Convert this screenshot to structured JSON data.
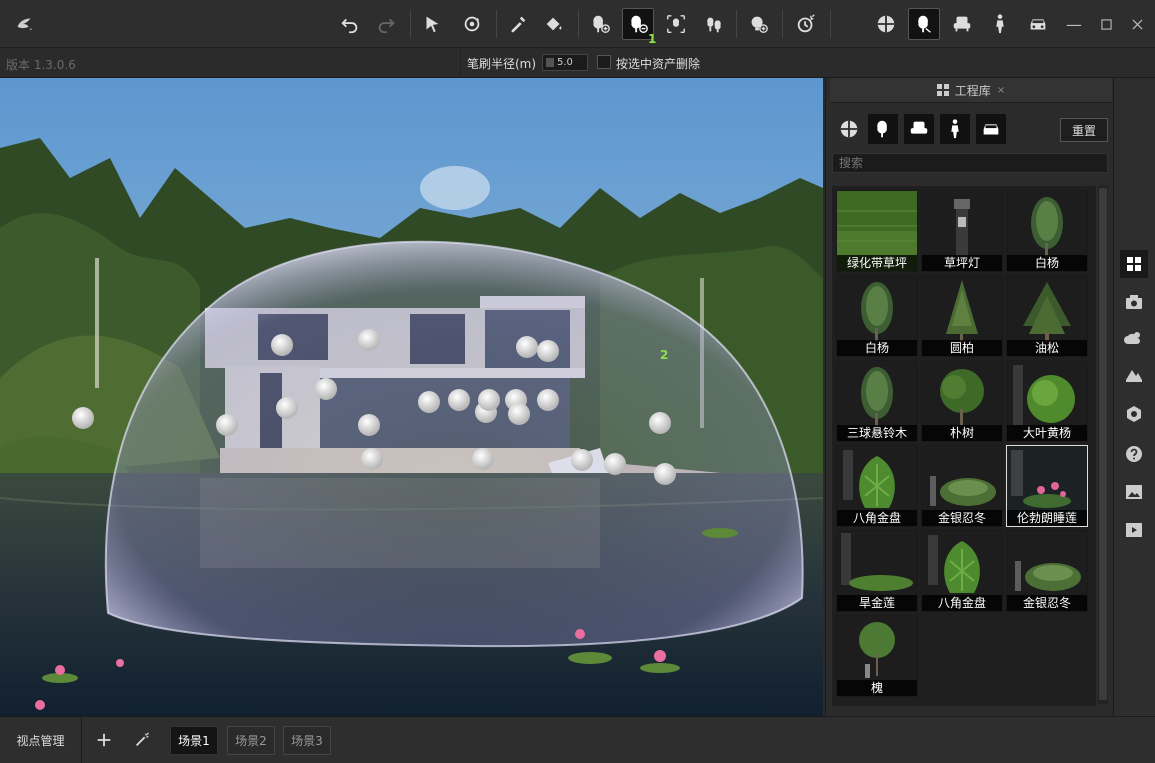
{
  "toolbar": {
    "badge_label": "1"
  },
  "subbar": {
    "version": "版本 1.3.0.6",
    "brush_label": "笔刷半径(m)",
    "brush_value": "5.0",
    "delete_label": "按选中资产删除"
  },
  "viewport": {
    "dome_label": "2"
  },
  "panel": {
    "title": "工程库",
    "reset_label": "重置",
    "search_placeholder": "搜索",
    "assets": [
      {
        "label": "绿化带草坪",
        "icon": "grass"
      },
      {
        "label": "草坪灯",
        "icon": "lamp"
      },
      {
        "label": "白杨",
        "icon": "tree-tall"
      },
      {
        "label": "白杨",
        "icon": "tree-tall"
      },
      {
        "label": "圆柏",
        "icon": "tree-cone"
      },
      {
        "label": "油松",
        "icon": "tree-pine"
      },
      {
        "label": "三球悬铃木",
        "icon": "tree-tall"
      },
      {
        "label": "朴树",
        "icon": "tree-round"
      },
      {
        "label": "大叶黄杨",
        "icon": "shrub-round"
      },
      {
        "label": "八角金盘",
        "icon": "plant-leafy"
      },
      {
        "label": "金银忍冬",
        "icon": "shrub-low"
      },
      {
        "label": "伦勃朗睡莲",
        "icon": "lotus"
      },
      {
        "label": "旱金莲",
        "icon": "groundcover"
      },
      {
        "label": "八角金盘",
        "icon": "plant-leafy"
      },
      {
        "label": "金银忍冬",
        "icon": "shrub-low"
      },
      {
        "label": "槐",
        "icon": "tree-small"
      }
    ]
  },
  "bottom": {
    "viewpoint_label": "视点管理",
    "scenes": [
      "场景1",
      "场景2",
      "场景3"
    ]
  }
}
